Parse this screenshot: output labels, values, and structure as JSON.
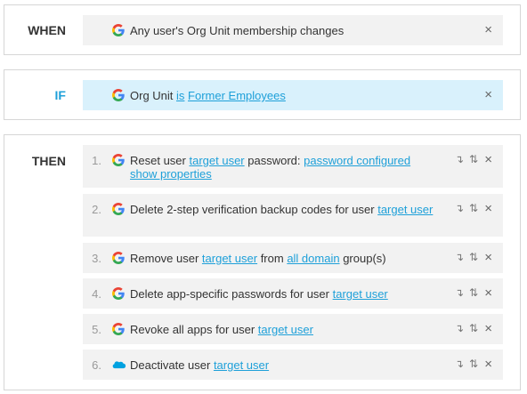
{
  "when": {
    "label": "WHEN",
    "trigger": "Any user's Org Unit membership changes"
  },
  "if": {
    "label": "IF",
    "prefix": "Org Unit ",
    "operator": "is",
    "value": "Former Employees"
  },
  "then": {
    "label": "THEN",
    "steps": [
      {
        "num": "1.",
        "provider": "google",
        "parts": [
          "Reset user ",
          "target user",
          " password: ",
          "password configured show properties"
        ]
      },
      {
        "num": "2.",
        "provider": "google",
        "parts": [
          "Delete 2-step verification backup codes for user ",
          "target user"
        ]
      },
      {
        "num": "3.",
        "provider": "google",
        "parts": [
          "Remove user ",
          "target user",
          " from ",
          "all domain",
          " group(s)"
        ]
      },
      {
        "num": "4.",
        "provider": "google",
        "parts": [
          "Delete app-specific passwords for user ",
          "target user"
        ]
      },
      {
        "num": "5.",
        "provider": "google",
        "parts": [
          "Revoke all apps for user ",
          "target user"
        ]
      },
      {
        "num": "6.",
        "provider": "salesforce",
        "parts": [
          "Deactivate user ",
          "target user"
        ]
      }
    ]
  },
  "icons": {
    "close": "×",
    "move_down": "↴",
    "reorder": "⇅"
  },
  "colors": {
    "accent": "#1ea0d9",
    "row_bg": "#f2f2f2",
    "highlight_bg": "#d9f1fc"
  }
}
